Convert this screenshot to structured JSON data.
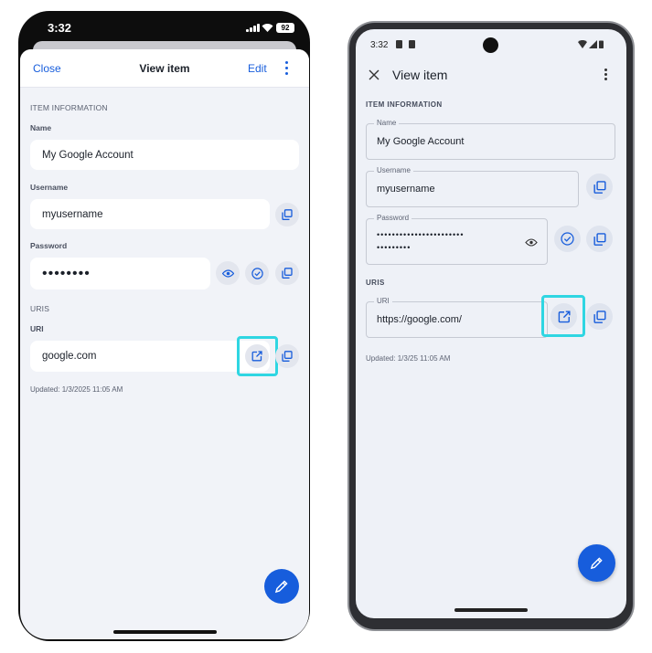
{
  "colors": {
    "accent": "#175ddc",
    "highlight": "#2fd6e2",
    "surface": "#f1f3f8"
  },
  "ios": {
    "status": {
      "time": "3:32",
      "battery": "92"
    },
    "nav": {
      "close": "Close",
      "title": "View item",
      "edit": "Edit",
      "more_icon": "more-vertical-icon"
    },
    "section_item": "ITEM INFORMATION",
    "name": {
      "label": "Name",
      "value": "My Google Account"
    },
    "username": {
      "label": "Username",
      "value": "myusername"
    },
    "password": {
      "label": "Password",
      "value": "••••••••"
    },
    "section_uris": "URIS",
    "uri": {
      "label": "URI",
      "value": "google.com"
    },
    "updated": "Updated: 1/3/2025 11:05 AM"
  },
  "android": {
    "status": {
      "time": "3:32"
    },
    "header": {
      "title": "View item",
      "close_icon": "close-icon"
    },
    "section_item": "ITEM INFORMATION",
    "name": {
      "label": "Name",
      "value": "My Google Account"
    },
    "username": {
      "label": "Username",
      "value": "myusername"
    },
    "password": {
      "label": "Password",
      "line1": "•••••••••••••••••••••••",
      "line2": "•••••••••"
    },
    "section_uris": "URIS",
    "uri": {
      "label": "URI",
      "value": "https://google.com/"
    },
    "updated": "Updated: 1/3/25 11:05 AM"
  }
}
